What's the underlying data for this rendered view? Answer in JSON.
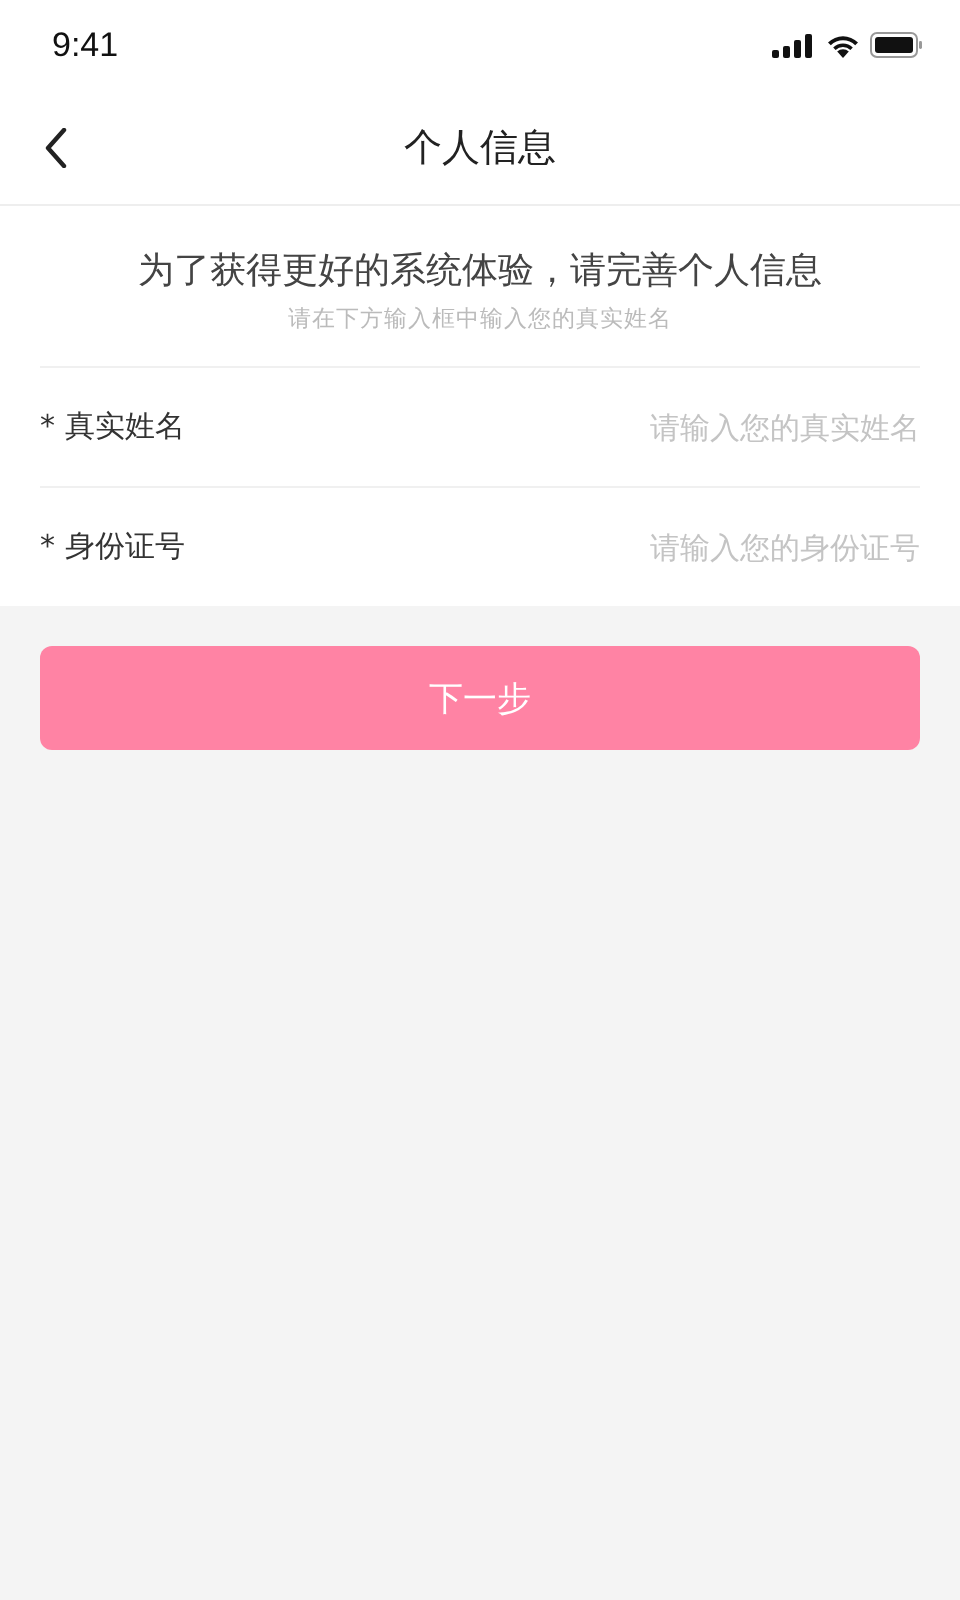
{
  "status_bar": {
    "time": "9:41"
  },
  "nav": {
    "title": "个人信息"
  },
  "intro": {
    "heading": "为了获得更好的系统体验，请完善个人信息",
    "hint": "请在下方输入框中输入您的真实姓名"
  },
  "fields": [
    {
      "label": "* 真实姓名",
      "placeholder": "请输入您的真实姓名"
    },
    {
      "label": "* 身份证号",
      "placeholder": "请输入您的身份证号"
    }
  ],
  "next_button": {
    "label": "下一步",
    "disabled": true
  }
}
